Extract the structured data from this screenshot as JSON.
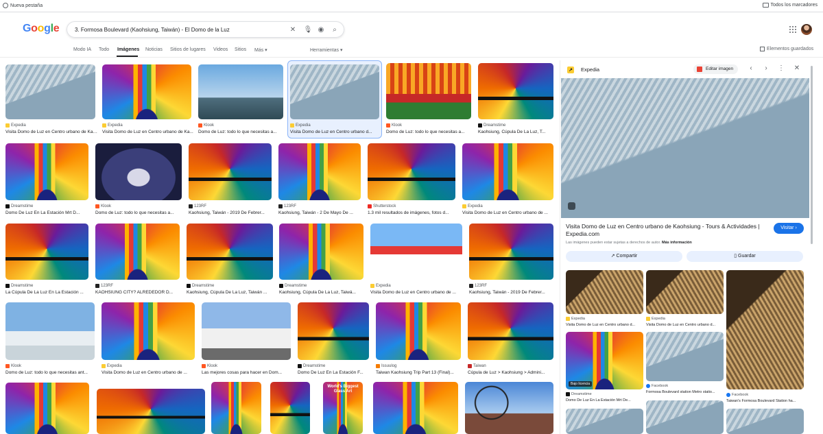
{
  "bookmarks": {
    "new_tab": "Nueva pestaña",
    "all_bookmarks": "Todos los marcadores"
  },
  "search": {
    "query": "3. Formosa Boulevard (Kaohsiung, Taiwán) - El Domo de la Luz"
  },
  "tabs": [
    "Modo IA",
    "Todo",
    "Imágenes",
    "Noticias",
    "Sitios de lugares",
    "Videos",
    "Sitios",
    "Más",
    "Herramientas"
  ],
  "saved_label": "Elementos guardados",
  "results": [
    {
      "source": "Expedia",
      "caption": "Visita Domo de Luz en Centro urbano de Kaohsiung -...",
      "img": "glass"
    },
    {
      "source": "Expedia",
      "caption": "Visita Domo de Luz en Centro urbano de Ka...",
      "img": "dome"
    },
    {
      "source": "Klook",
      "caption": "Domo de Luz: todo lo que necesitas a...",
      "img": "sky"
    },
    {
      "source": "Expedia",
      "caption": "Visita Domo de Luz en Centro urbano d...",
      "img": "glass"
    },
    {
      "source": "Klook",
      "caption": "Domo de Luz: todo lo que necesitas a...",
      "img": "pagoda"
    },
    {
      "source": "Dreamstime",
      "caption": "Kaohsiung, Cúpula De La Luz, T...",
      "img": "dome2"
    },
    {
      "source": "Dreamstime",
      "caption": "Domo De Luz En La Estación Mrt D...",
      "img": "dome"
    },
    {
      "source": "Klook",
      "caption": "Domo de Luz: todo lo que necesitas a...",
      "img": "night"
    },
    {
      "source": "123RF",
      "caption": "Kaohsiung, Taiwán - 2019 De Febrer...",
      "img": "dome2"
    },
    {
      "source": "123RF",
      "caption": "Kaohsiung, Taiwán - 2 De Mayo De ...",
      "img": "dome"
    },
    {
      "source": "Shutterstock",
      "caption": "1.3 mil resultados de imágenes, fotos d...",
      "img": "dome2"
    },
    {
      "source": "Expedia",
      "caption": "Visita Domo de Luz en Centro urbano de ...",
      "img": "dome"
    },
    {
      "source": "Dreamstime",
      "caption": "La Cúpula De La Luz En La Estación ...",
      "img": "dome2"
    },
    {
      "source": "123RF",
      "caption": "KAOHSIUNG CITY? ALREDEDOR D...",
      "img": "dome"
    },
    {
      "source": "Dreamstime",
      "caption": "Kaohsiung, Cúpula De La Luz, Taiwán ...",
      "img": "dome2"
    },
    {
      "source": "Dreamstime",
      "caption": "Kaohsiung, Cúpula De La Luz, Taiwá...",
      "img": "dome"
    },
    {
      "source": "Expedia",
      "caption": "Visita Domo de Luz en Centro urbano de ...",
      "img": "piano"
    },
    {
      "source": "123RF",
      "caption": "Kaohsiung, Taiwán - 2019 De Febrer...",
      "img": "dome2"
    },
    {
      "source": "Klook",
      "caption": "Domo de Luz: todo lo que necesitas ant...",
      "img": "harbour"
    },
    {
      "source": "Expedia",
      "caption": "Visita Domo de Luz en Centro urbano de ...",
      "img": "dome"
    },
    {
      "source": "Klook",
      "caption": "Las mejores cosas para hacer en Dom...",
      "img": "building"
    },
    {
      "source": "Dreamstime",
      "caption": "Domo De Luz En La Estación F...",
      "img": "dome2"
    },
    {
      "source": "Issuulog",
      "caption": "Taiwan Kaohsiung Trip Part 13 (Final)...",
      "img": "dome"
    },
    {
      "source": "Taiwan",
      "caption": "Cúpula de Luz > Kaohsiung > Admini...",
      "img": "dome2"
    },
    {
      "source": "",
      "caption": "",
      "img": "dome"
    },
    {
      "source": "",
      "caption": "",
      "img": "dome2"
    },
    {
      "source": "",
      "caption": "",
      "img": "dome"
    },
    {
      "source": "",
      "caption": "",
      "img": "dome2"
    },
    {
      "source": "",
      "caption": "",
      "img": "dome"
    },
    {
      "source": "",
      "caption": "",
      "img": "dome"
    },
    {
      "source": "",
      "caption": "",
      "img": "ferris"
    }
  ],
  "overlay_text": "World's Biggest Glass Art",
  "panel": {
    "brand": "Expedia",
    "edit_label": "Editar imagen",
    "title": "Visita Domo de Luz en Centro urbano de Kaohsiung - Tours & Actividades | Expedia.com",
    "visit_label": "Visitar",
    "rights_text": "Las imágenes pueden estar sujetas a derechos de autor.",
    "rights_link": "Más información",
    "share_label": "Compartir",
    "save_label": "Guardar",
    "related": [
      {
        "source": "Expedia",
        "caption": "Visita Domo de Luz en Centro urbano d..."
      },
      {
        "source": "Expedia",
        "caption": "Visita Domo de Luz en Centro urbano d..."
      },
      {
        "source": "Facebook",
        "caption": "Taiwan's Formosa Boulevard Station ha..."
      },
      {
        "source": "Dreamstime",
        "caption": "Domo De Luz En La Estación Mrt De..."
      },
      {
        "source": "Facebook",
        "caption": "Formosa Boulevard station Metro statio..."
      }
    ],
    "badge": "Bajo licencia"
  },
  "colors": {
    "accent": "#1a73e8",
    "selected_border": "#8ab4f8"
  }
}
